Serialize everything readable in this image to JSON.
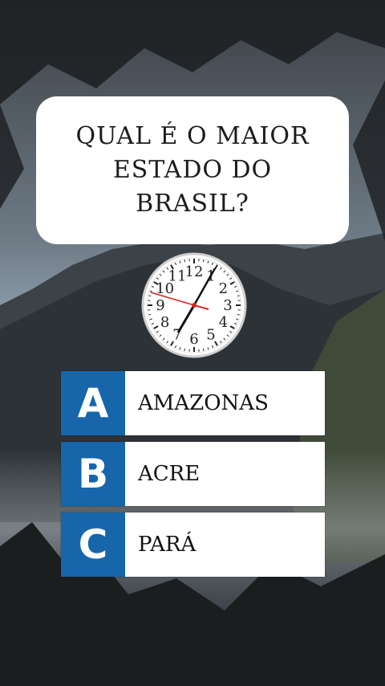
{
  "question": "QUAL É O MAIOR ESTADO DO BRASIL?",
  "question_line1": "QUAL É O MAIOR",
  "question_line2": "ESTADO DO BRASIL?",
  "clock": {
    "numbers": [
      "12",
      "1",
      "2",
      "3",
      "4",
      "5",
      "6",
      "7",
      "8",
      "9",
      "10",
      "11"
    ],
    "hour_hand_time": "7:03",
    "second_hand_color": "#d9261c"
  },
  "answers": [
    {
      "letter": "A",
      "text": "AMAZONAS"
    },
    {
      "letter": "B",
      "text": "ACRE"
    },
    {
      "letter": "C",
      "text": "PARÁ"
    }
  ],
  "colors": {
    "accent": "#1766ac",
    "card": "#ffffff"
  }
}
